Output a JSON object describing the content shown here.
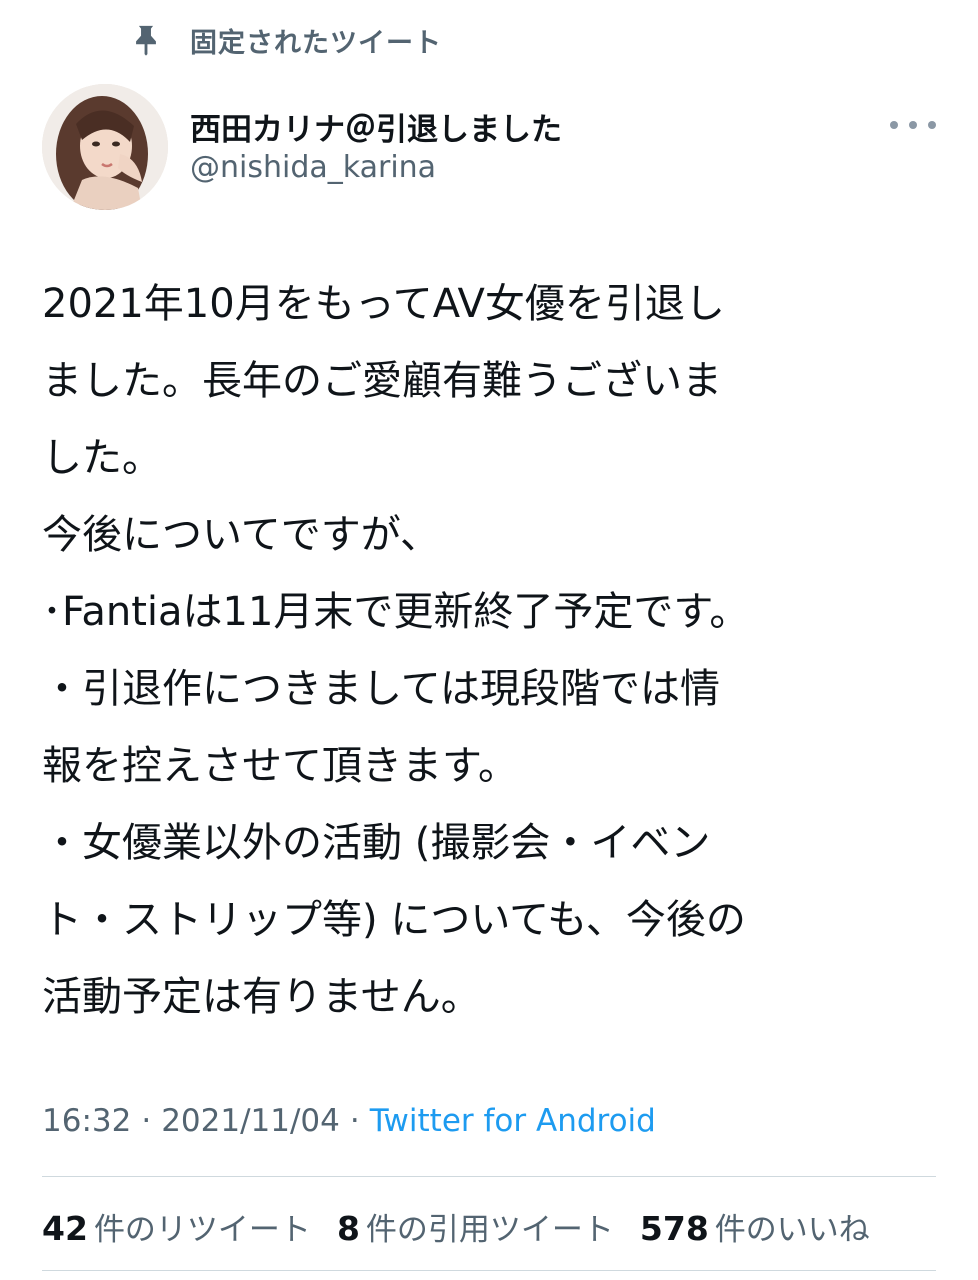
{
  "pinned": {
    "label": "固定されたツイート",
    "icon": "pin-icon"
  },
  "author": {
    "display_name": "西田カリナ＠引退しました",
    "handle": "@nishida_karina",
    "avatar": "avatar"
  },
  "more_icon": "more-icon",
  "tweet": {
    "lines": [
      "2021年10月をもってAV女優を引退し",
      "ました。長年のご愛顧有難うございま",
      "した。",
      "今後についてですが、",
      "･Fantiaは11月末で更新終了予定です。",
      "・引退作につきましては現段階では情",
      "報を控えさせて頂きます。",
      "・女優業以外の活動 (撮影会・イベン",
      "ト・ストリップ等) についても、今後の",
      "活動予定は有りません。"
    ]
  },
  "meta": {
    "time": "16:32",
    "date": "2021/11/04",
    "separator": "·",
    "source": "Twitter for Android"
  },
  "stats": {
    "retweets": {
      "count": "42",
      "label": "件のリツイート"
    },
    "quotes": {
      "count": "8",
      "label": "件の引用ツイート"
    },
    "likes": {
      "count": "578",
      "label": "件のいいね"
    }
  },
  "colors": {
    "text": "#0f1419",
    "secondary": "#536471",
    "link": "#1d9bf0",
    "divider": "#cfd9de"
  }
}
